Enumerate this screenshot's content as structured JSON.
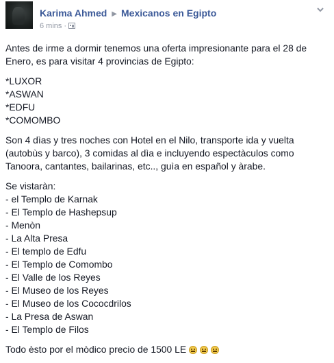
{
  "post": {
    "author": "Karima Ahmed",
    "group": "Mexicanos en Egipto",
    "time": "6 mins",
    "separator": "·",
    "audience_icon": "group-audience-icon",
    "menu_icon": "chevron-down-icon",
    "paragraphs": [
      [
        "Antes de irme a dormir tenemos una oferta impresionante para el 28 de",
        "Enero, es para visitar 4 provincias de Egipto:"
      ],
      [
        "*LUXOR",
        "*ASWAN",
        "*EDFU",
        "*COMOMBO"
      ],
      [
        "Son 4 dìas y tres noches con Hotel en el Nilo, transporte ida y vuelta",
        "(autobùs y barco), 3 comidas al dìa e incluyendo espectàculos como",
        "Tanoora, cantantes, bailarinas, etc.., guìa en español y àrabe."
      ],
      [
        "Se vistaràn:",
        "- el Templo de Karnak",
        "- El Templo de Hashepsup",
        "- Menòn",
        "- La Alta Presa",
        "- El templo de Edfu",
        "- El Templo de Comombo",
        "- El Valle de los Reyes",
        "- El Museo de los Reyes",
        "- El Museo de los Cococdrilos",
        "- La Presa de Aswan",
        "- El Templo de Filos"
      ]
    ],
    "closing": "Todo èsto por el mòdico precio de 1500 LE",
    "emoji_icons": [
      "grimace-emoji-icon",
      "grimace-emoji-icon",
      "grimace-emoji-icon"
    ]
  }
}
